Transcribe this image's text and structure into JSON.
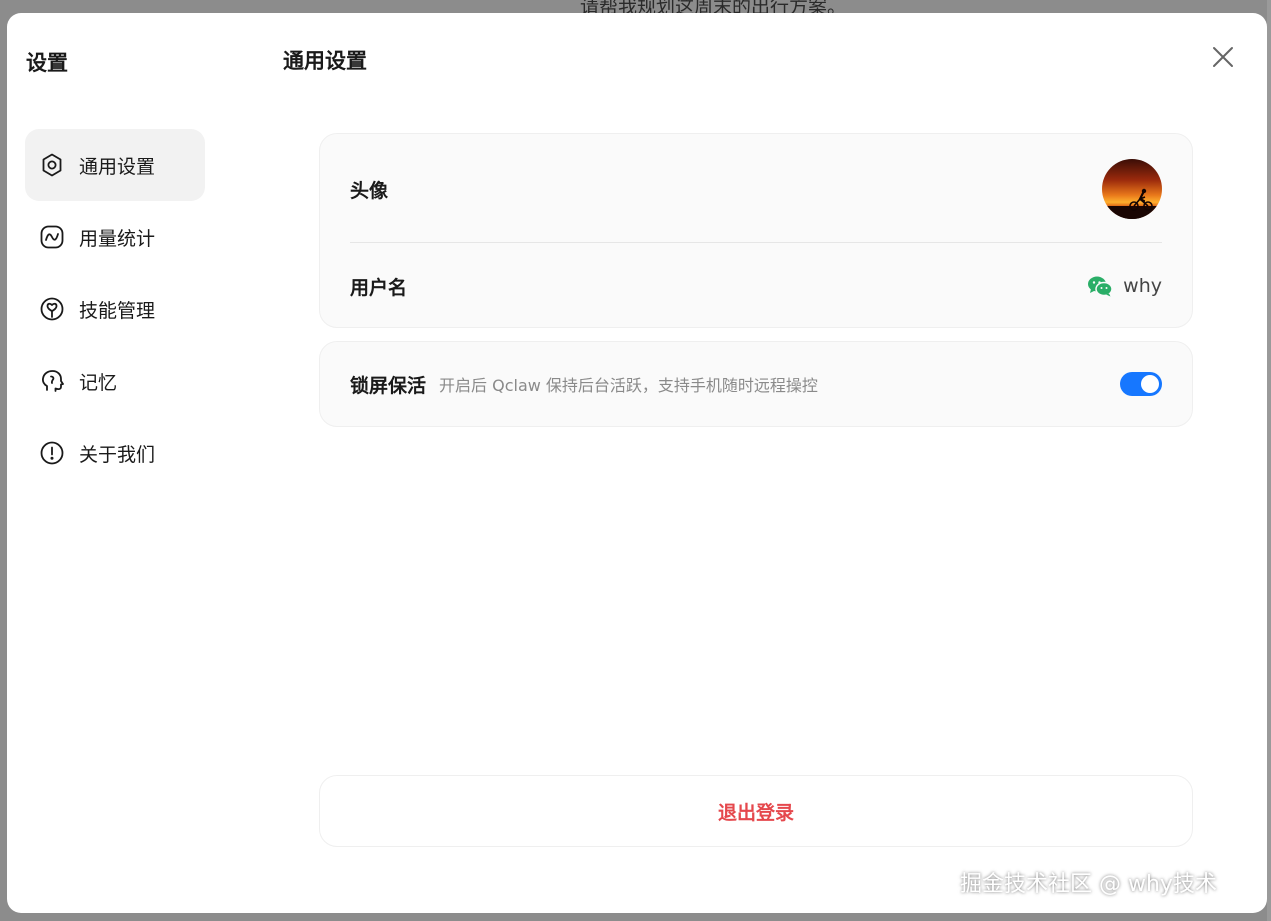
{
  "backdrop": {
    "prompt_text": "请帮我规划这周末的出行方案。"
  },
  "sidebar": {
    "title": "设置",
    "items": [
      {
        "label": "通用设置",
        "icon": "gear-icon",
        "active": true
      },
      {
        "label": "用量统计",
        "icon": "chart-line-icon",
        "active": false
      },
      {
        "label": "技能管理",
        "icon": "skill-icon",
        "active": false
      },
      {
        "label": "记忆",
        "icon": "brain-icon",
        "active": false
      },
      {
        "label": "关于我们",
        "icon": "info-icon",
        "active": false
      }
    ]
  },
  "main": {
    "title": "通用设置",
    "profile": {
      "avatar_label": "头像",
      "username_label": "用户名",
      "username_value": "why",
      "username_source_icon": "wechat-icon"
    },
    "lock_screen": {
      "label": "锁屏保活",
      "description": "开启后 Qclaw 保持后台活跃，支持手机随时远程操控",
      "enabled": true
    },
    "logout_label": "退出登录"
  },
  "watermark": "掘金技术社区 @ why技术",
  "colors": {
    "accent": "#1677ff",
    "danger": "#e5484d",
    "wechat": "#2aae67",
    "active_nav_bg": "#f2f2f2"
  }
}
